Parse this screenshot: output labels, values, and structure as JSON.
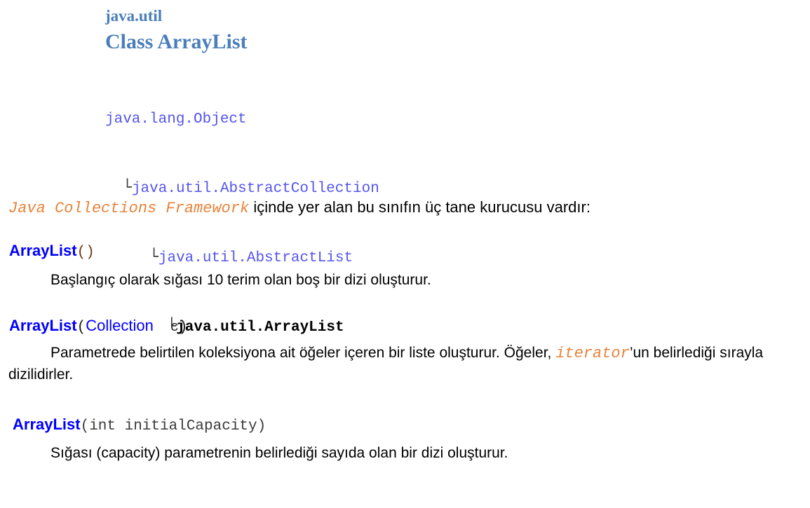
{
  "header": {
    "package": "java.util",
    "class_title": "Class ArrayList"
  },
  "hierarchy": {
    "nodes": [
      {
        "branch": "",
        "label": "java.lang.Object",
        "bold": false,
        "indent": 0
      },
      {
        "branch": "└",
        "label": "java.util.AbstractCollection",
        "bold": false,
        "indent": 1
      },
      {
        "branch": "└",
        "label": "java.util.AbstractList",
        "bold": false,
        "indent": 2
      },
      {
        "branch": "└",
        "label": "java.util.ArrayList",
        "bold": true,
        "indent": 3
      }
    ]
  },
  "intro": {
    "code_term": "Java Collections Framework",
    "text": " içinde yer alan bu sınıfın üç tane kurucusu vardır:"
  },
  "constructors": [
    {
      "name": "ArrayList",
      "open_paren": "(",
      "type": "",
      "arg": "",
      "close_paren": ")",
      "description": "Başlangıç olarak sığası 10 terim olan boş bir dizi oluşturur."
    },
    {
      "name": "ArrayList",
      "open_paren": "(",
      "type": "Collection",
      "arg": "c",
      "close_paren": ")",
      "description_part1": "Parametrede belirtilen koleksiyona ait öğeler içeren bir liste oluşturur.  Öğeler, ",
      "description_code": "iterator",
      "description_part2": "’un belirlediği sırayla dizilidirler."
    },
    {
      "name": "ArrayList",
      "params": "(int initialCapacity)",
      "description": "Sığası (capacity) parametrenin belirlediği sayıda olan bir dizi oluşturur."
    }
  ],
  "colors": {
    "heading_blue": "#4a7ebb",
    "tree_blue": "#5555ee",
    "signature_blue": "#0000ff",
    "code_orange": "#e8833a",
    "text_black": "#000000"
  }
}
